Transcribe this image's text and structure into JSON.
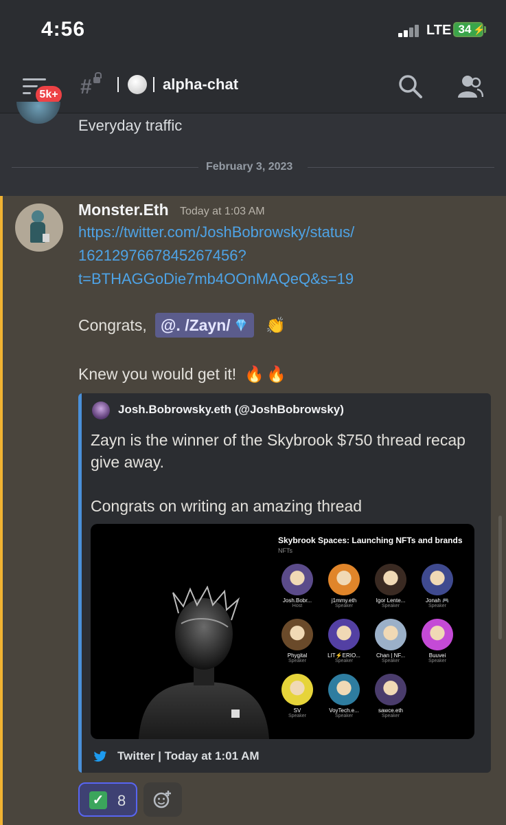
{
  "status_bar": {
    "time": "4:56",
    "network": "LTE",
    "battery": "34"
  },
  "header": {
    "badge": "5k+",
    "channel_name": "alpha-chat",
    "icons": [
      "menu-icon",
      "locked-channel-icon",
      "search-icon",
      "members-icon"
    ]
  },
  "previous_message": {
    "text": "Everyday traffic"
  },
  "date_divider": "February 3, 2023",
  "message": {
    "username": "Monster.Eth",
    "timestamp": "Today at 1:03 AM",
    "link_lines": [
      "https://twitter.com/JoshBobrowsky/status/",
      "1621297667845267456?",
      "t=BTHAGGoDie7mb4OOnMAQeQ&s=19"
    ],
    "congrats_text": "Congrats,",
    "mention": "@. /Zayn/",
    "knew_text": "Knew you would get it!",
    "emojis": {
      "clap": "👏",
      "fire": "🔥"
    },
    "highlight_color": "#f0b232"
  },
  "embed": {
    "author": "Josh.Bobrowsky.eth (@JoshBobrowsky)",
    "description": [
      "Zayn is the winner of the Skybrook $750 thread recap give away.",
      "Congrats on writing an amazing thread"
    ],
    "image": {
      "title": "Skybrook Spaces: Launching NFTs and brands",
      "subtitle": "NFTs",
      "speakers": [
        {
          "name": "Josh.Bobr...",
          "role": "Host",
          "color": "#5b4b8a"
        },
        {
          "name": "j1mmy.eth",
          "role": "Speaker",
          "color": "#e0852a"
        },
        {
          "name": "Igor Lente...",
          "role": "Speaker",
          "color": "#3a2a22"
        },
        {
          "name": "Jonah 🎮",
          "role": "Speaker",
          "color": "#3f4a8f"
        },
        {
          "name": "Phygital",
          "role": "Speaker",
          "color": "#6a4a2a"
        },
        {
          "name": "LIT⚡ERIO...",
          "role": "Speaker",
          "color": "#5340a3"
        },
        {
          "name": "Chan | NF...",
          "role": "Speaker",
          "color": "#9bb0c8"
        },
        {
          "name": "Buuvei",
          "role": "Speaker",
          "color": "#c44ad6"
        },
        {
          "name": "SV",
          "role": "Speaker",
          "color": "#e6d43a"
        },
        {
          "name": "VoyTech.e...",
          "role": "Speaker",
          "color": "#2e7da0"
        },
        {
          "name": "sawce.eth",
          "role": "Speaker",
          "color": "#4a3c6c"
        }
      ]
    },
    "footer": "Twitter | Today at 1:01 AM",
    "accent": "#4a90d9"
  },
  "reactions": [
    {
      "emoji": "✅",
      "count": "8"
    }
  ],
  "add_reaction_icon": "add-reaction-icon"
}
